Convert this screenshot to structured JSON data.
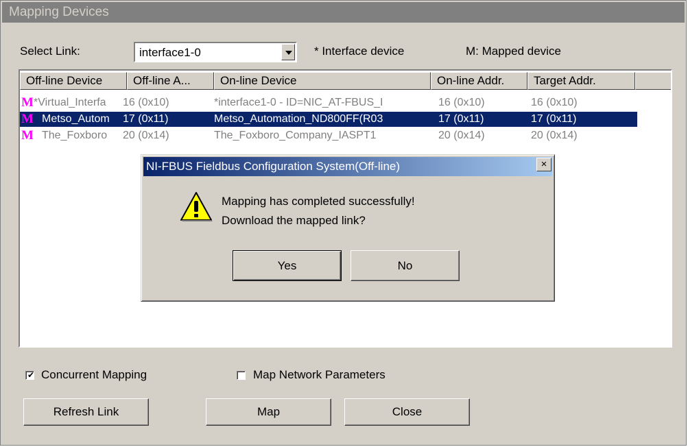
{
  "window": {
    "title": "Mapping Devices"
  },
  "link": {
    "label": "Select Link:",
    "value": "interface1-0"
  },
  "legend": {
    "interface": "* Interface device",
    "mapped": "M: Mapped device"
  },
  "columns": [
    "Off-line Device",
    "Off-line A...",
    "On-line Device",
    "On-line Addr.",
    "Target Addr."
  ],
  "rows": [
    {
      "offline_device": "*Virtual_Interfa",
      "offline_addr": "16 (0x10)",
      "online_device": "*interface1-0 - ID=NIC_AT-FBUS_I",
      "online_addr": "16 (0x10)",
      "target_addr": "16 (0x10)",
      "selected": false
    },
    {
      "offline_device": "Metso_Autom",
      "offline_addr": "17 (0x11)",
      "online_device": "Metso_Automation_ND800FF(R03",
      "online_addr": "17 (0x11)",
      "target_addr": "17 (0x11)",
      "selected": true
    },
    {
      "offline_device": "The_Foxboro",
      "offline_addr": "20 (0x14)",
      "online_device": "The_Foxboro_Company_IASPT1",
      "online_addr": "20 (0x14)",
      "target_addr": "20 (0x14)",
      "selected": false
    }
  ],
  "mapped_marker": "M",
  "dialog": {
    "title": "NI-FBUS Fieldbus Configuration System(Off-line)",
    "close": "×",
    "message_line1": "Mapping has completed successfully!",
    "message_line2": "Download the mapped link?",
    "yes": "Yes",
    "no": "No"
  },
  "options": {
    "concurrent_mapping": {
      "label": "Concurrent Mapping",
      "checked": true
    },
    "map_network_parameters": {
      "label": "Map Network Parameters",
      "checked": false
    }
  },
  "buttons": {
    "refresh": "Refresh Link",
    "map": "Map",
    "close": "Close"
  },
  "colors": {
    "selection": "#0a246a",
    "mapped_icon": "#ff00ff",
    "face": "#d4d0c8"
  }
}
